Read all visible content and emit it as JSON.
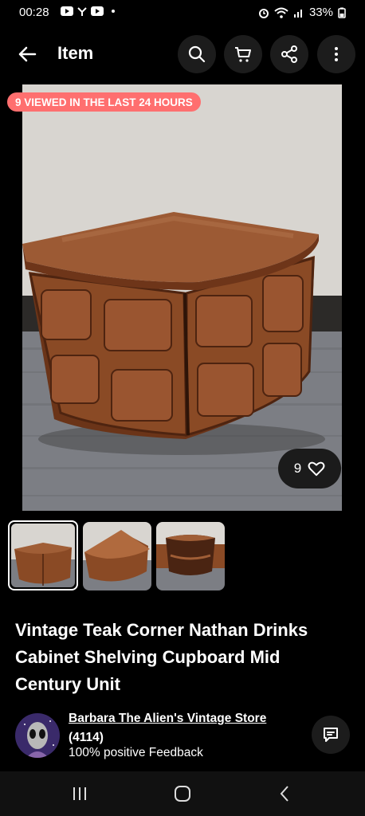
{
  "status_bar": {
    "time": "00:28",
    "battery": "33%"
  },
  "app_bar": {
    "title": "Item",
    "icons": [
      "back-arrow-icon",
      "search-icon",
      "cart-icon",
      "share-icon",
      "more-vertical-icon"
    ]
  },
  "hero": {
    "banner": "9 VIEWED IN THE LAST 24 HOURS",
    "watch_count": "9"
  },
  "thumbnails": {
    "count": 3,
    "selected_index": 0
  },
  "item": {
    "title": "Vintage Teak Corner Nathan Drinks Cabinet Shelving Cupboard Mid Century Unit"
  },
  "seller": {
    "name": "Barbara The Alien's Vintage Store",
    "rating_count": "(4114)",
    "feedback": "100% positive Feedback"
  },
  "colors": {
    "banner": "#ff6f6f",
    "background": "#000000",
    "teak": "#8a4a25"
  }
}
